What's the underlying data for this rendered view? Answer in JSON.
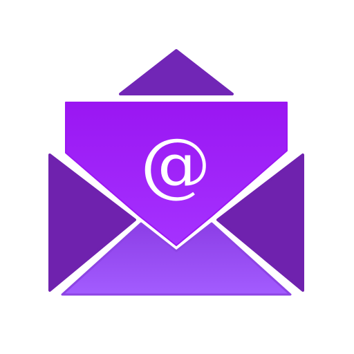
{
  "icon": {
    "name": "open-envelope-mail-icon",
    "symbol": "@",
    "colors": {
      "background": "#ffffff",
      "envelope_dark": "#6f22ae",
      "envelope_flap_top": "#7126b6",
      "letter_top": "#9a16f2",
      "letter_bottom": "#a532ff",
      "front_panel_top": "#8c3ee6",
      "front_panel_bottom": "#a35cff",
      "symbol": "#ffffff"
    }
  }
}
